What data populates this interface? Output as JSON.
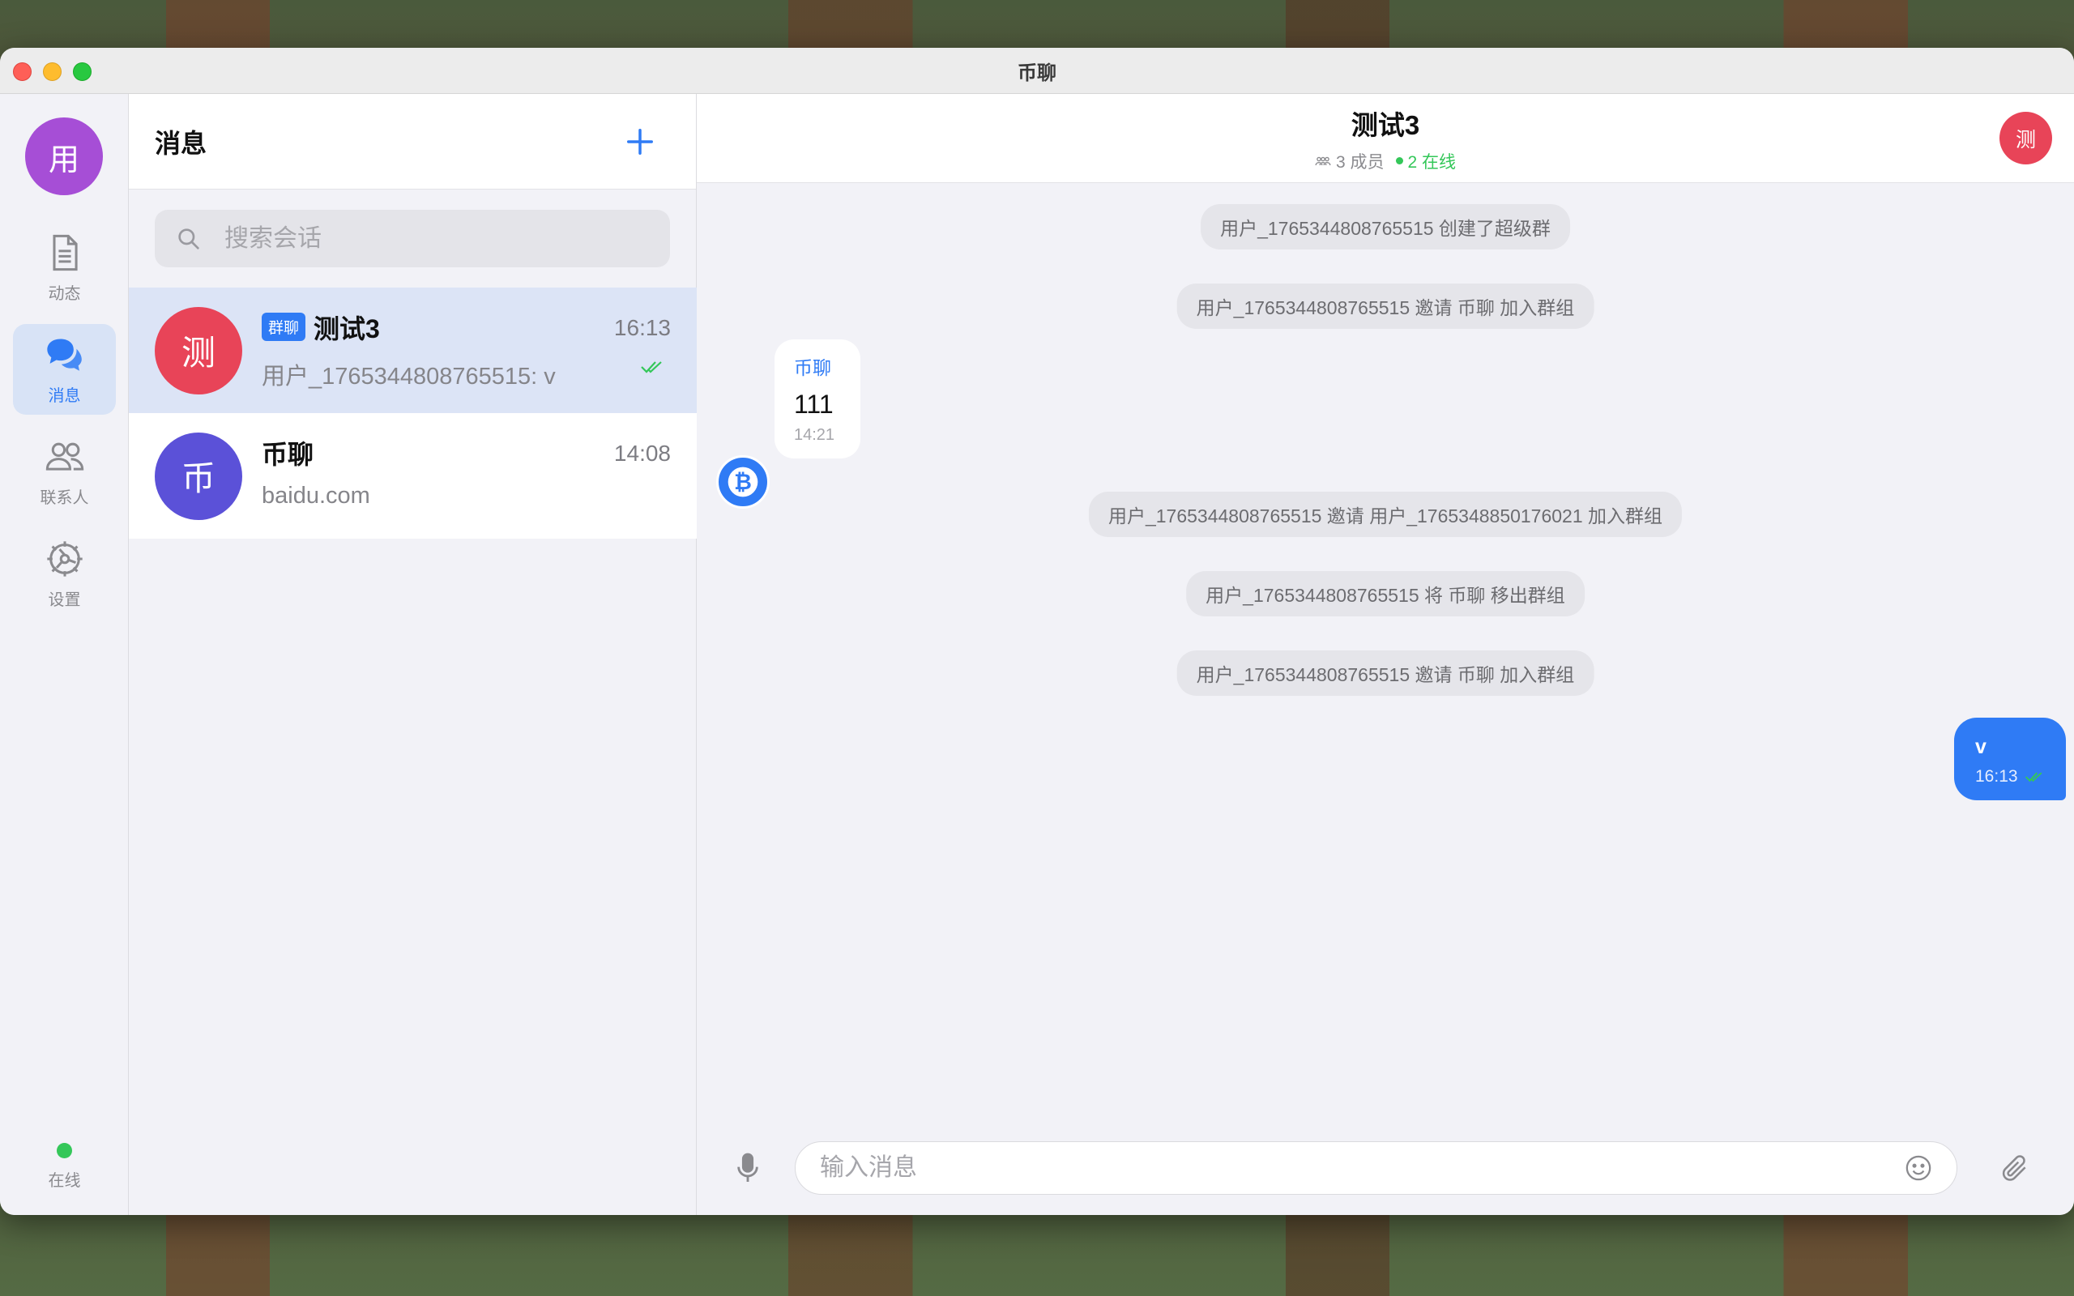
{
  "window": {
    "title": "币聊"
  },
  "rail": {
    "me_avatar": "用",
    "items": [
      {
        "label": "动态",
        "icon": "document-icon"
      },
      {
        "label": "消息",
        "icon": "chat-bubbles-icon",
        "active": true
      },
      {
        "label": "联系人",
        "icon": "contacts-icon"
      },
      {
        "label": "设置",
        "icon": "gear-icon"
      }
    ],
    "status": "在线"
  },
  "list": {
    "title": "消息",
    "search_placeholder": "搜索会话",
    "conversations": [
      {
        "avatar": "测",
        "badge": "群聊",
        "name": "测试3",
        "time": "16:13",
        "preview": "用户_1765344808765515: v",
        "avatar_color": "#e84458"
      },
      {
        "avatar": "币",
        "name": "币聊",
        "time": "14:08",
        "preview": "baidu.com",
        "avatar_color": "#5b51d8"
      }
    ]
  },
  "chat": {
    "title": "测试3",
    "members": "3 成员",
    "online": "2 在线",
    "avatar": "测",
    "system_messages": [
      "用户_1765344808765515 创建了超级群",
      "用户_1765344808765515 邀请 币聊 加入群组",
      "用户_1765344808765515 邀请 用户_1765348850176021 加入群组",
      "用户_1765344808765515 将 币聊 移出群组",
      "用户_1765344808765515 邀请 币聊 加入群组"
    ],
    "incoming": {
      "sender": "币聊",
      "text": "111",
      "time": "14:21"
    },
    "outgoing": {
      "text": "v",
      "time": "16:13"
    },
    "input_placeholder": "输入消息"
  },
  "colors": {
    "accent": "#2f7bf5",
    "online": "#34c759"
  }
}
